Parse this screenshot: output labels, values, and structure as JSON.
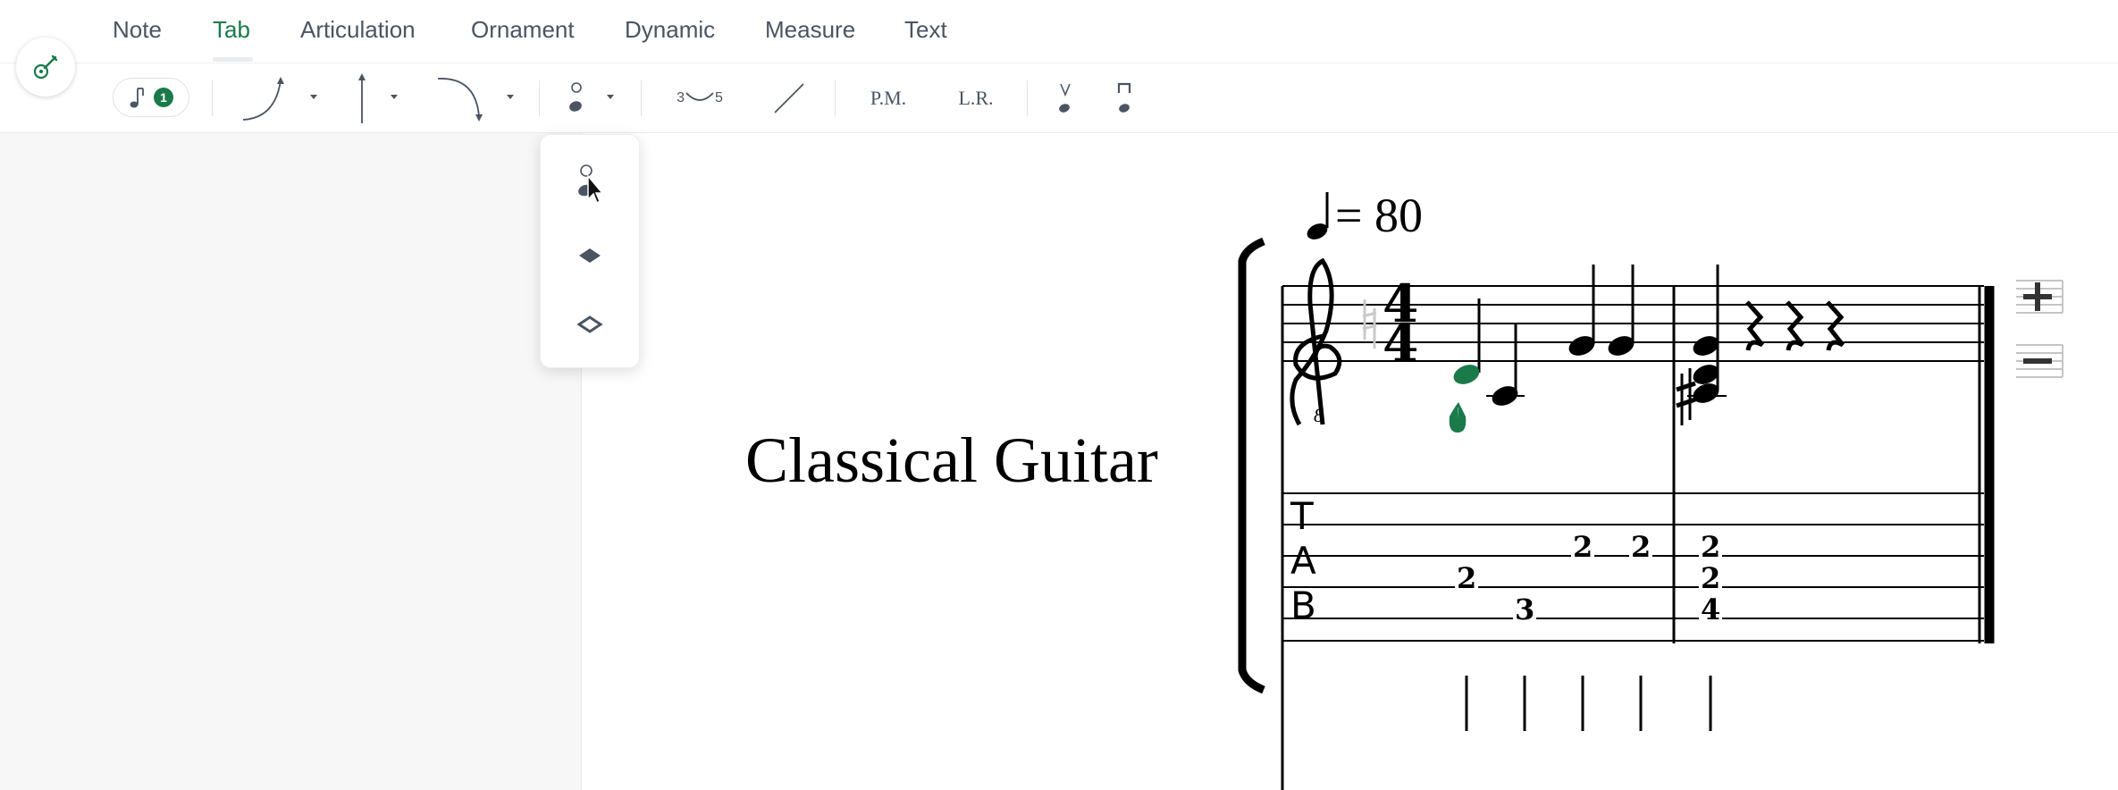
{
  "tabs": [
    {
      "label": "Note"
    },
    {
      "label": "Tab"
    },
    {
      "label": "Articulation"
    },
    {
      "label": "Ornament"
    },
    {
      "label": "Dynamic"
    },
    {
      "label": "Measure"
    },
    {
      "label": "Text"
    }
  ],
  "active_tab": "Tab",
  "toolbar": {
    "voice_count": "1",
    "slur_from": "3",
    "slur_to": "5",
    "palm_mute": "P.M.",
    "let_ring": "L.R."
  },
  "score": {
    "title": "Classical Guitar",
    "tempo": "= 80",
    "tab_clef": [
      "T",
      "A",
      "B"
    ],
    "time_signature": [
      "4",
      "4"
    ],
    "measure1_frets": [
      "2",
      "3",
      "2",
      "2"
    ],
    "measure2_frets": [
      "2",
      "2",
      "4"
    ]
  },
  "colors": {
    "accent": "#1a7a4a",
    "tab_text": "#4a5462",
    "selected_note": "#1a7a4a"
  }
}
